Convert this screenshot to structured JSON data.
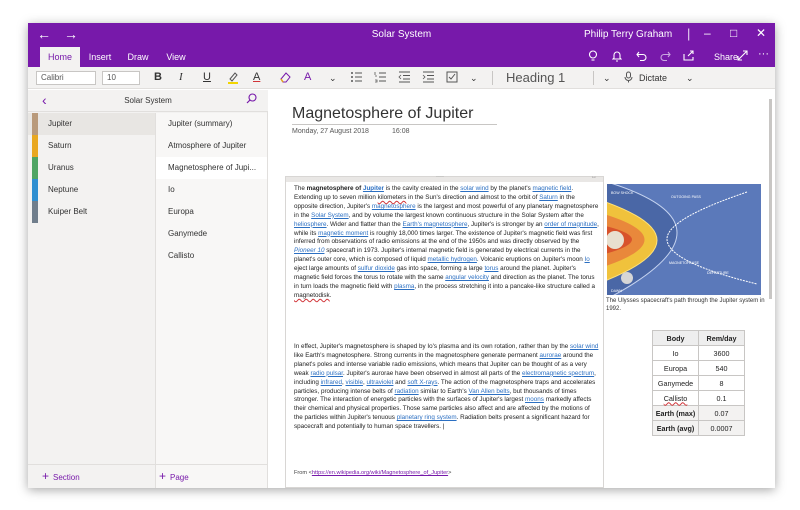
{
  "window": {
    "title": "Solar System",
    "user": "Philip Terry Graham",
    "nav_back": "←",
    "nav_forward": "→",
    "minimize": "–",
    "maximize": "□",
    "close": "✕"
  },
  "ribbon": {
    "tabs": [
      {
        "label": "Home",
        "active": true
      },
      {
        "label": "Insert",
        "active": false
      },
      {
        "label": "Draw",
        "active": false
      },
      {
        "label": "View",
        "active": false
      }
    ],
    "share_label": "Share",
    "icons": [
      "lightbulb-icon",
      "bell-icon",
      "undo-icon",
      "redo-icon",
      "share-icon",
      "fullscreen-icon",
      "more-icon"
    ]
  },
  "toolbar": {
    "font_name": "Calibri",
    "font_size": "10",
    "bold": "B",
    "italic": "I",
    "underline": "U",
    "highlight": "🖊",
    "font_color": "A",
    "eraser": "⌫",
    "format_painter": "A",
    "style": "Heading 1",
    "dictate": "Dictate",
    "chevron": "⌄"
  },
  "notebook": {
    "name": "Solar System",
    "sections": [
      {
        "label": "Jupiter",
        "color": "#b99a7b",
        "selected": true
      },
      {
        "label": "Saturn",
        "color": "#e9a821",
        "selected": false
      },
      {
        "label": "Uranus",
        "color": "#4fa564",
        "selected": false
      },
      {
        "label": "Neptune",
        "color": "#2f8fd1",
        "selected": false
      },
      {
        "label": "Kuiper Belt",
        "color": "#707e8c",
        "selected": false
      }
    ],
    "pages": [
      {
        "label": "Jupiter (summary)",
        "selected": false
      },
      {
        "label": "Atmosphere of Jupiter",
        "selected": false
      },
      {
        "label": "Magnetosphere of Jupi...",
        "selected": true
      },
      {
        "label": "Io",
        "selected": false
      },
      {
        "label": "Europa",
        "selected": false
      },
      {
        "label": "Ganymede",
        "selected": false
      },
      {
        "label": "Callisto",
        "selected": false
      }
    ],
    "add_section": "Section",
    "add_page": "Page"
  },
  "page": {
    "title": "Magnetosphere of Jupiter",
    "date": "Monday, 27 August 2018",
    "time": "16:08",
    "source_prefix": "From <",
    "source_url": "https://en.wikipedia.org/wiki/Magnetosphere_of_Jupiter",
    "source_suffix": ">",
    "image_caption": "The Ulysses spacecraft's path through the Jupiter system in 1992.",
    "image_labels": [
      "BOW SHOCK",
      "OUTGOING PASS",
      "MAGNETOPAUSE",
      "DEPARTURE",
      "DAWN"
    ],
    "table": {
      "headers": [
        "Body",
        "Rem/day"
      ],
      "rows": [
        [
          "Io",
          "3600"
        ],
        [
          "Europa",
          "540"
        ],
        [
          "Ganymede",
          "8"
        ],
        [
          "Callisto",
          "0.1"
        ],
        [
          "Earth (max)",
          "0.07"
        ],
        [
          "Earth (avg)",
          "0.0007"
        ]
      ]
    }
  }
}
